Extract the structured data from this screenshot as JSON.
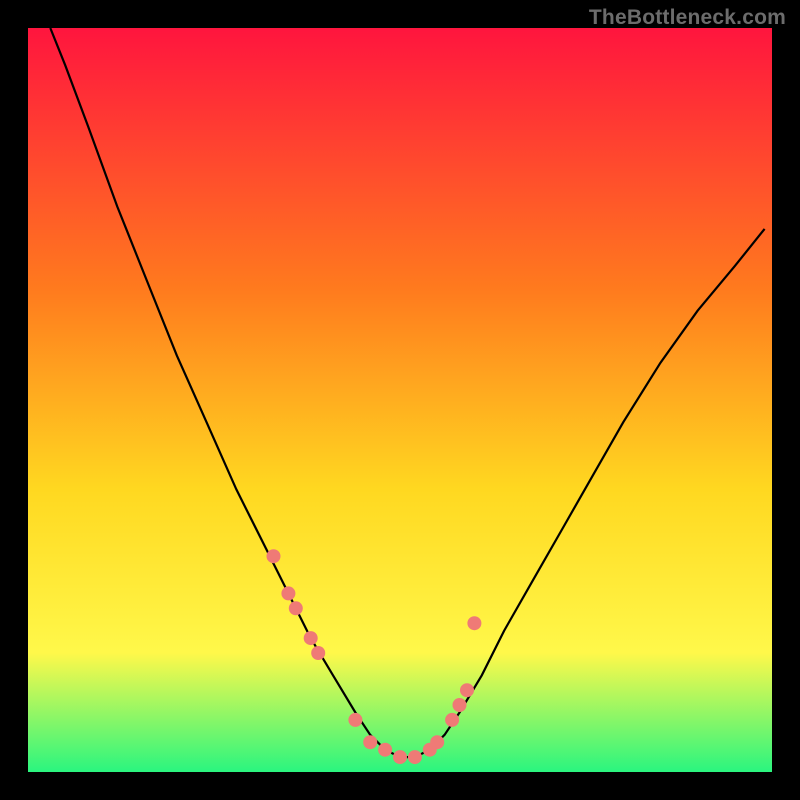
{
  "watermark": {
    "text": "TheBottleneck.com"
  },
  "colors": {
    "gradient_top": "#ff153e",
    "gradient_mid1": "#ff7a1e",
    "gradient_mid2": "#ffd820",
    "gradient_mid3": "#fff84a",
    "gradient_bottom": "#2af57f",
    "curve": "#000000",
    "dots": "#ef7a76",
    "frame": "#000000"
  },
  "chart_data": {
    "type": "line",
    "title": "",
    "xlabel": "",
    "ylabel": "",
    "xlim": [
      0,
      100
    ],
    "ylim": [
      0,
      100
    ],
    "grid": false,
    "series": [
      {
        "name": "curve",
        "x": [
          3,
          5,
          8,
          12,
          16,
          20,
          24,
          28,
          32,
          35,
          38,
          41,
          44,
          46,
          48,
          50,
          52,
          54,
          56,
          58,
          61,
          64,
          68,
          72,
          76,
          80,
          85,
          90,
          95,
          99
        ],
        "y": [
          100,
          95,
          87,
          76,
          66,
          56,
          47,
          38,
          30,
          24,
          18,
          13,
          8,
          5,
          3,
          2,
          2,
          3,
          5,
          8,
          13,
          19,
          26,
          33,
          40,
          47,
          55,
          62,
          68,
          73
        ]
      }
    ],
    "points": {
      "name": "markers",
      "x": [
        33,
        35,
        36,
        38,
        39,
        44,
        46,
        48,
        50,
        52,
        54,
        55,
        57,
        58,
        59,
        60
      ],
      "y": [
        29,
        24,
        22,
        18,
        16,
        7,
        4,
        3,
        2,
        2,
        3,
        4,
        7,
        9,
        11,
        20
      ]
    }
  }
}
